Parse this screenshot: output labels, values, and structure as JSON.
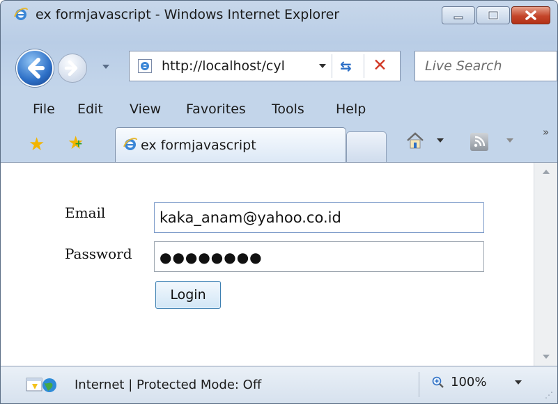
{
  "window": {
    "title": "ex formjavascript - Windows Internet Explorer",
    "controls": {
      "minimize": "minimize",
      "maximize": "maximize",
      "close": "close"
    }
  },
  "nav": {
    "address": "http://localhost/cyl",
    "search_placeholder": "Live Search"
  },
  "menu": {
    "items": [
      "File",
      "Edit",
      "View",
      "Favorites",
      "Tools",
      "Help"
    ]
  },
  "tabs": {
    "active_title": "ex formjavascript"
  },
  "form": {
    "email_label": "Email",
    "email_value": "kaka_anam@yahoo.co.id",
    "password_label": "Password",
    "password_masked": "●●●●●●●●",
    "login_label": "Login"
  },
  "status": {
    "zone_text": "Internet | Protected Mode: Off",
    "zoom_text": "100%"
  },
  "colors": {
    "accent": "#2d6fc6",
    "close_red": "#c4452a",
    "chrome_bg": "#c3d5ea"
  }
}
